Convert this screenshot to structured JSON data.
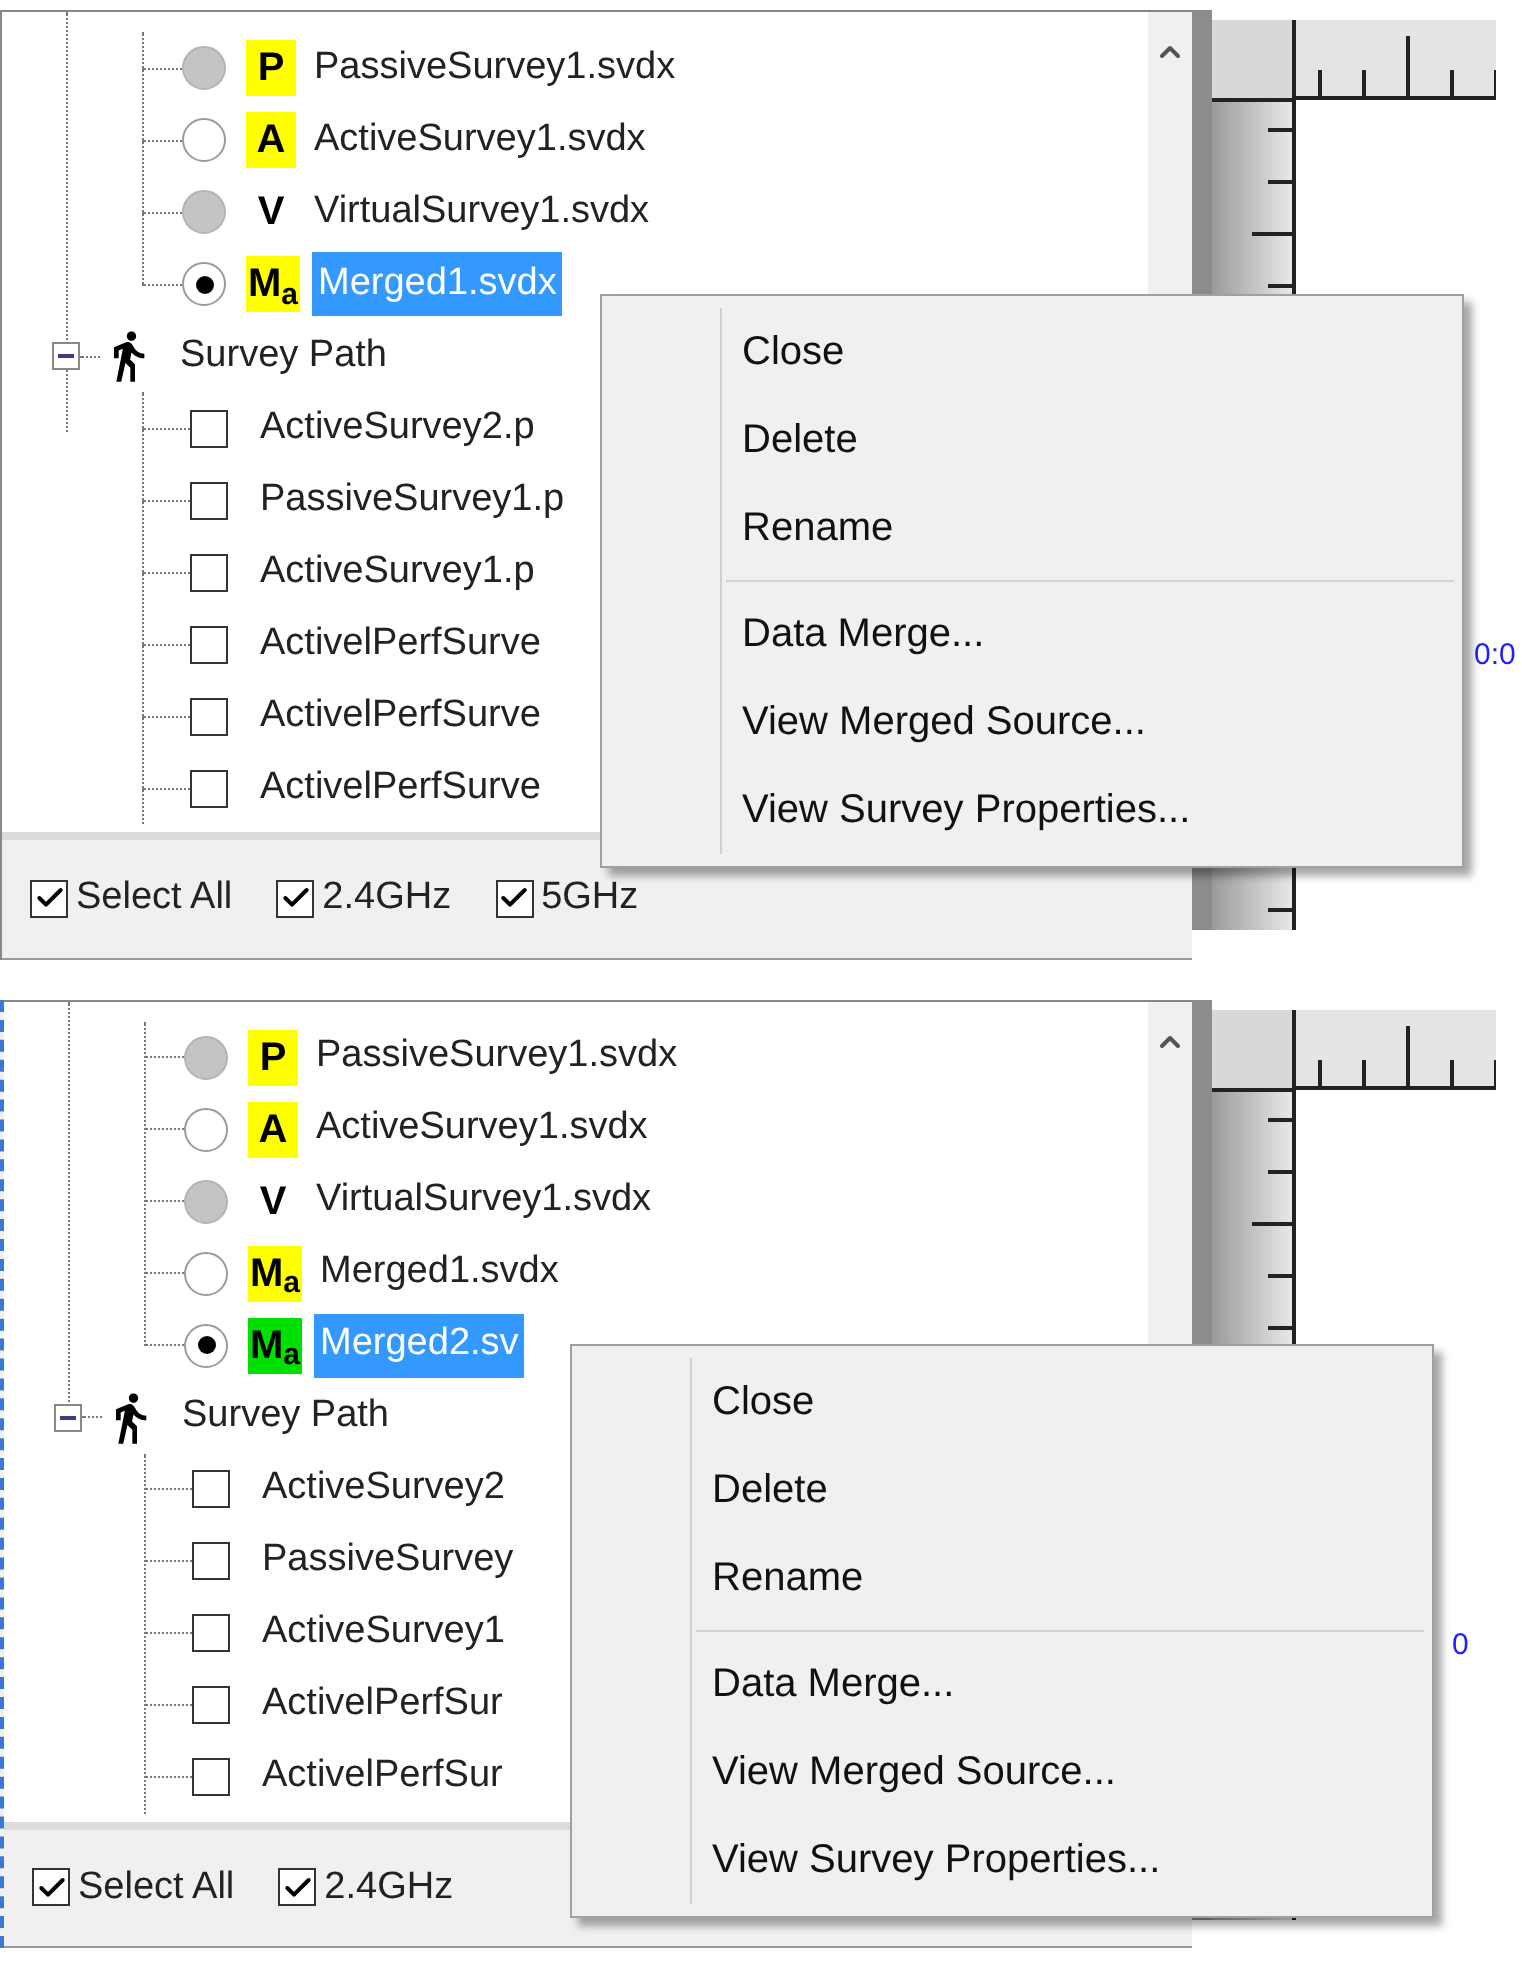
{
  "panels": [
    {
      "focused": false,
      "files": [
        {
          "badge": "P",
          "color": "#ffff00",
          "disabled": true,
          "selected": false,
          "label": "PassiveSurvey1.svdx"
        },
        {
          "badge": "A",
          "color": "#ffff00",
          "disabled": false,
          "selected": false,
          "label": "ActiveSurvey1.svdx"
        },
        {
          "badge": "V",
          "disabled": true,
          "selected": false,
          "label": "VirtualSurvey1.svdx"
        },
        {
          "badge": "M$_{a}$",
          "color": "#ffff00",
          "disabled": false,
          "selected": true,
          "label": "Merged1.svdx"
        }
      ],
      "survey_path": {
        "label": "Survey Path",
        "expanded": true,
        "children": [
          {
            "label": "ActiveSurvey2.p",
            "checked": false
          },
          {
            "label": "PassiveSurvey1.p",
            "checked": false
          },
          {
            "label": "ActiveSurvey1.p",
            "checked": false
          },
          {
            "label": "ActivelPerfSurve",
            "checked": false
          },
          {
            "label": "ActivelPerfSurve",
            "checked": false
          },
          {
            "label": "ActivelPerfSurve",
            "checked": false
          }
        ]
      },
      "filters": [
        {
          "label": "Select All",
          "checked": true
        },
        {
          "label": "2.4GHz",
          "checked": true
        },
        {
          "label": "5GHz",
          "checked": true
        }
      ],
      "ruler_label": "0:0",
      "menu": [
        [
          "Close",
          "Delete",
          "Rename"
        ],
        [
          "Data Merge...",
          "View Merged Source...",
          "View Survey Properties..."
        ]
      ]
    },
    {
      "focused": true,
      "files": [
        {
          "badge": "P",
          "color": "#ffff00",
          "disabled": true,
          "selected": false,
          "label": "PassiveSurvey1.svdx"
        },
        {
          "badge": "A",
          "color": "#ffff00",
          "disabled": false,
          "selected": false,
          "label": "ActiveSurvey1.svdx"
        },
        {
          "badge": "V",
          "disabled": true,
          "selected": false,
          "label": "VirtualSurvey1.svdx"
        },
        {
          "badge": "M$_{a}$",
          "color": "#ffff00",
          "disabled": false,
          "selected": false,
          "label": "Merged1.svdx"
        },
        {
          "badge": "M$_{a}$",
          "color": "#00e000",
          "disabled": false,
          "selected": true,
          "label": "Merged2.sv"
        }
      ],
      "survey_path": {
        "label": "Survey Path",
        "expanded": true,
        "children": [
          {
            "label": "ActiveSurvey2",
            "checked": false
          },
          {
            "label": "PassiveSurvey",
            "checked": false
          },
          {
            "label": "ActiveSurvey1",
            "checked": false
          },
          {
            "label": "ActivelPerfSur",
            "checked": false
          },
          {
            "label": "ActivelPerfSur",
            "checked": false
          }
        ]
      },
      "filters": [
        {
          "label": "Select All",
          "checked": true
        },
        {
          "label": "2.4GHz",
          "checked": true
        }
      ],
      "ruler_label": "0",
      "menu": [
        [
          "Close",
          "Delete",
          "Rename"
        ],
        [
          "Data Merge...",
          "View Merged Source...",
          "View Survey Properties..."
        ]
      ]
    }
  ]
}
